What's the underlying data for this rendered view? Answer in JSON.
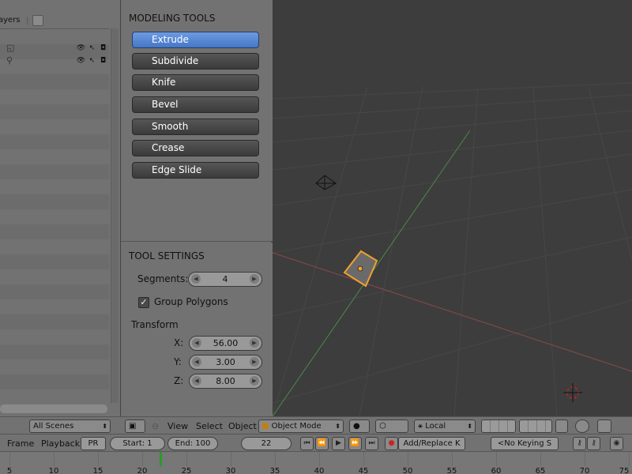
{
  "outliner": {
    "header_text": "ayers",
    "rows": [
      {
        "glyph": "◱",
        "icons": [
          "👁",
          "↖",
          "◘"
        ]
      },
      {
        "glyph": "⚲",
        "icons": [
          "👁",
          "↖",
          "◘"
        ]
      }
    ]
  },
  "scenes": {
    "selected": "All Scenes"
  },
  "modeling_tools": {
    "title": "MODELING TOOLS",
    "buttons": [
      {
        "label": "Extrude",
        "active": true
      },
      {
        "label": "Subdivide",
        "active": false
      },
      {
        "label": "Knife",
        "active": false
      },
      {
        "label": "Bevel",
        "active": false
      },
      {
        "label": "Smooth",
        "active": false
      },
      {
        "label": "Crease",
        "active": false
      },
      {
        "label": "Edge Slide",
        "active": false
      }
    ]
  },
  "tool_settings": {
    "title": "TOOL SETTINGS",
    "segments_label": "Segments:",
    "segments_value": "4",
    "group_polygons_label": "Group Polygons",
    "group_polygons_checked": true,
    "transform_label": "Transform",
    "x_label": "X:",
    "x_value": "56.00",
    "y_label": "Y:",
    "y_value": "3.00",
    "z_label": "Z:",
    "z_value": "8.00"
  },
  "view_header": {
    "menu_view": "View",
    "menu_select": "Select",
    "menu_object": "Object",
    "mode": "Object Mode",
    "pivot": "Local"
  },
  "timeline_header": {
    "frame": "Frame",
    "playback": "Playback",
    "pr": "PR",
    "start": "Start: 1",
    "end": "End: 100",
    "current": "22",
    "keying": "Add/Replace K",
    "keying_set": "<No Keying S"
  },
  "timeline": {
    "labels": [
      "5",
      "10",
      "15",
      "20",
      "25",
      "30",
      "35",
      "40",
      "45",
      "50",
      "55",
      "60",
      "65",
      "70",
      "75"
    ],
    "current_frame": 22
  },
  "colors": {
    "active_button": "#4a7fd0",
    "selection_outline": "#f0a030",
    "x_axis": "#a04040",
    "y_axis": "#4a9a4a"
  }
}
